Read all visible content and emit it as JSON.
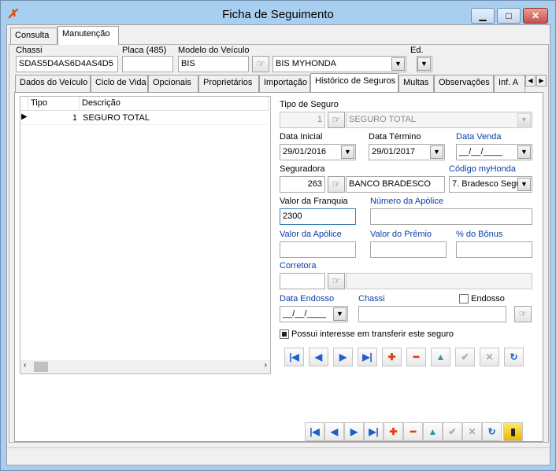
{
  "window": {
    "title": "Ficha de Seguimento",
    "minimize": "▁",
    "maximize": "□",
    "close": "✕"
  },
  "outer_tabs": [
    "Consulta",
    "Manutenção"
  ],
  "header": {
    "chassi_label": "Chassi",
    "chassi_value": "SDAS5D4AS6D4AS4D5",
    "placa_label": "Placa (485)",
    "placa_value": "",
    "modelo_label": "Modelo do Veículo",
    "modelo_code": "BIS",
    "modelo_desc": "BIS MYHONDA",
    "ed_label": "Ed.",
    "ed_value": ""
  },
  "inner_tabs": [
    "Dados do Veículo",
    "Ciclo de Vida",
    "Opcionais",
    "Proprietários",
    "Importação",
    "Histórico de Seguros",
    "Multas",
    "Observações",
    "Inf. A"
  ],
  "grid": {
    "columns": [
      "Tipo",
      "Descrição"
    ],
    "rows": [
      {
        "tipo": "1",
        "descricao": "SEGURO TOTAL"
      }
    ],
    "row_indicator": "▶"
  },
  "form": {
    "tipo_seguro_label": "Tipo de Seguro",
    "tipo_seguro_code": "1",
    "tipo_seguro_desc": "SEGURO TOTAL",
    "data_inicial_label": "Data Inicial",
    "data_inicial_value": "29/01/2016",
    "data_termino_label": "Data Término",
    "data_termino_value": "29/01/2017",
    "data_venda_label": "Data Venda",
    "data_venda_value": "__/__/____",
    "seguradora_label": "Seguradora",
    "seguradora_code": "263",
    "seguradora_desc": "BANCO BRADESCO",
    "codigo_myhonda_label": "Código myHonda",
    "codigo_myhonda_value": "7. Bradesco Segu",
    "valor_franquia_label": "Valor da Franquia",
    "valor_franquia_value": "2300",
    "numero_apolice_label": "Número da Apólice",
    "numero_apolice_value": "",
    "valor_apolice_label": "Valor da Apólice",
    "valor_apolice_value": "",
    "valor_premio_label": "Valor do Prêmio",
    "valor_premio_value": "",
    "pct_bonus_label": "% do Bônus",
    "pct_bonus_value": "",
    "corretora_label": "Corretora",
    "corretora_code": "",
    "corretora_desc": "",
    "data_endosso_label": "Data Endosso",
    "data_endosso_value": "__/__/____",
    "chassi_label": "Chassi",
    "chassi_value": "",
    "endosso_label": "Endosso",
    "transferir_label": "Possui  interesse em transferir este seguro"
  },
  "nav_icons": {
    "first": "|◀",
    "prev": "◀",
    "next": "▶",
    "last": "▶|",
    "add": "✚",
    "remove": "━",
    "edit": "▲",
    "confirm": "✔",
    "cancel": "✕",
    "refresh": "↻",
    "exit": "▮"
  },
  "lookup_icon": "☞",
  "dropdown_icon": "▼",
  "colors": {
    "window_frame": "#a9cff0",
    "label_blue": "#0b3ea8",
    "nav_blue": "#1f5fc8",
    "nav_red": "#e04010"
  }
}
